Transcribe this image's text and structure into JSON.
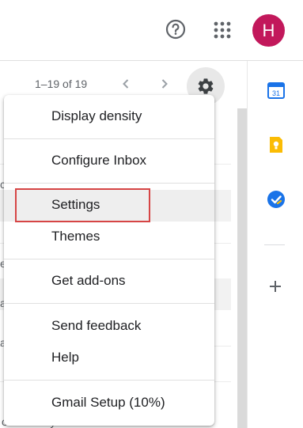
{
  "header": {
    "help_icon": "help-circle-icon",
    "apps_icon": "apps-grid-icon",
    "avatar_letter": "H",
    "avatar_color": "#c2185b"
  },
  "toolbar": {
    "range_text": "1–19 of 19",
    "prev_icon": "chevron-left-icon",
    "next_icon": "chevron-right-icon",
    "settings_icon": "gear-icon"
  },
  "list": {
    "fragments": [
      "c",
      "e",
      "a",
      "a",
      "ou recently adde..."
    ]
  },
  "settings_menu": {
    "items": [
      {
        "label": "Display density"
      },
      {
        "label": "Configure Inbox"
      },
      {
        "label": "Settings"
      },
      {
        "label": "Themes"
      },
      {
        "label": "Get add-ons"
      },
      {
        "label": "Send feedback"
      },
      {
        "label": "Help"
      },
      {
        "label": "Gmail Setup (10%)"
      }
    ],
    "highlighted_item": "Settings",
    "annotation_color": "#d64545"
  },
  "side_panel": {
    "icons": [
      "calendar-icon",
      "keep-icon",
      "tasks-icon",
      "add-icon"
    ],
    "calendar_day": "31",
    "colors": {
      "calendar": "#1a73e8",
      "keep": "#fbbc04",
      "tasks": "#1a73e8"
    }
  }
}
